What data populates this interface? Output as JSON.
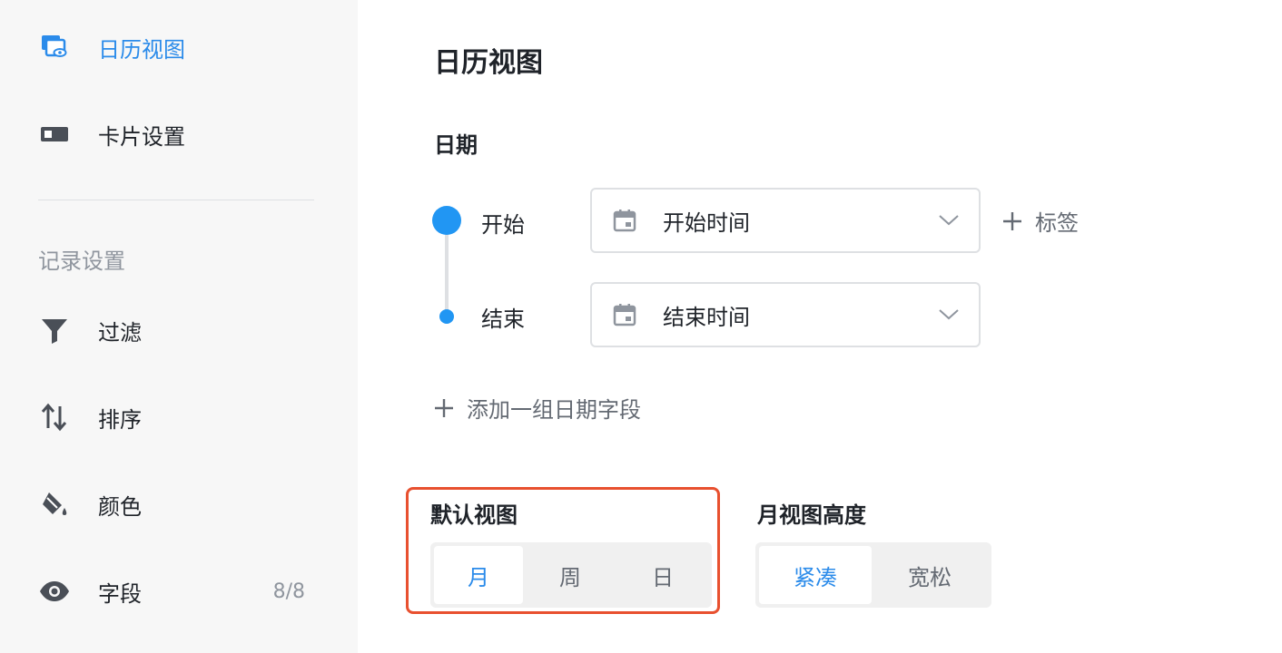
{
  "sidebar": {
    "items": [
      {
        "label": "日历视图",
        "icon": "calendar-view-icon"
      },
      {
        "label": "卡片设置",
        "icon": "card-icon"
      }
    ],
    "section_label": "记录设置",
    "record_items": [
      {
        "label": "过滤",
        "icon": "filter-icon"
      },
      {
        "label": "排序",
        "icon": "sort-icon"
      },
      {
        "label": "颜色",
        "icon": "paint-bucket-icon"
      },
      {
        "label": "字段",
        "icon": "eye-icon",
        "count": "8/8"
      }
    ]
  },
  "main": {
    "title": "日历视图",
    "date_section": {
      "title": "日期",
      "start_label": "开始",
      "start_value": "开始时间",
      "end_label": "结束",
      "end_value": "结束时间",
      "add_tag_label": "标签",
      "add_date_group_label": "添加一组日期字段"
    },
    "default_view": {
      "title": "默认视图",
      "options": [
        "月",
        "周",
        "日"
      ],
      "selected": "月"
    },
    "month_height": {
      "title": "月视图高度",
      "options": [
        "紧凑",
        "宽松"
      ],
      "selected": "紧凑"
    }
  },
  "colors": {
    "accent": "#2b8bea",
    "highlight": "#e8502f"
  }
}
